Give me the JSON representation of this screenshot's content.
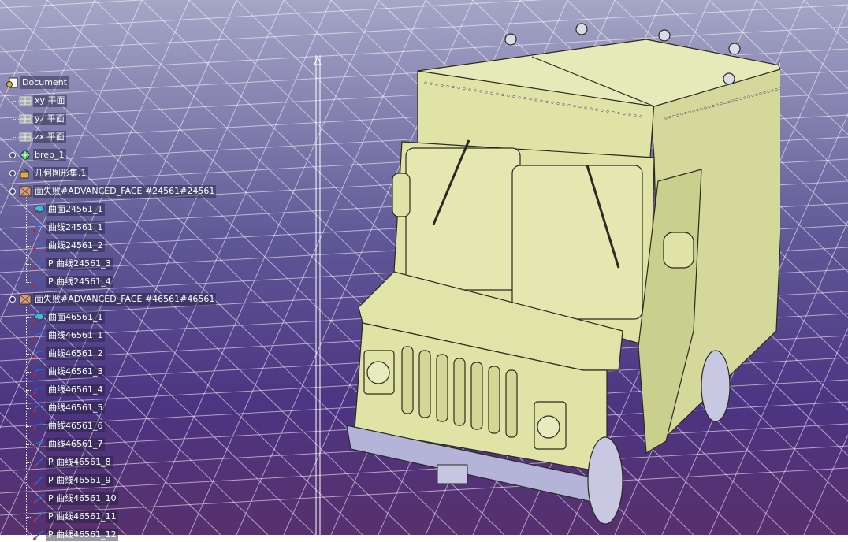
{
  "tree": {
    "root": {
      "label": "Document",
      "icon": "document-icon"
    },
    "planes": [
      {
        "label": "xy 平面",
        "icon": "plane-icon"
      },
      {
        "label": "yz 平面",
        "icon": "plane-icon"
      },
      {
        "label": "zx 平面",
        "icon": "plane-icon"
      }
    ],
    "brep": {
      "label": "brep_1",
      "icon": "body-icon"
    },
    "geoset": {
      "label": "几何图形集.1",
      "icon": "geometry-set-icon"
    },
    "failed_faces": [
      {
        "label": "面失败#ADVANCED_FACE #24561#24561",
        "icon": "failed-face-icon",
        "children": [
          {
            "label": "曲面24561_1",
            "icon": "surface-icon"
          },
          {
            "label": "曲线24561_1",
            "icon": "curve-icon"
          },
          {
            "label": "曲线24561_2",
            "icon": "curve-icon"
          },
          {
            "label": "P 曲线24561_3",
            "icon": "pcurve-icon"
          },
          {
            "label": "P 曲线24561_4",
            "icon": "pcurve-icon"
          }
        ]
      },
      {
        "label": "面失败#ADVANCED_FACE #46561#46561",
        "icon": "failed-face-icon",
        "children": [
          {
            "label": "曲面46561_1",
            "icon": "surface-icon"
          },
          {
            "label": "曲线46561_1",
            "icon": "curve-icon"
          },
          {
            "label": "曲线46561_2",
            "icon": "curve-icon"
          },
          {
            "label": "曲线46561_3",
            "icon": "curve-icon"
          },
          {
            "label": "曲线46561_4",
            "icon": "curve-icon"
          },
          {
            "label": "曲线46561_5",
            "icon": "curve-icon"
          },
          {
            "label": "曲线46561_6",
            "icon": "curve-icon"
          },
          {
            "label": "曲线46561_7",
            "icon": "curve-icon"
          },
          {
            "label": "P 曲线46561_8",
            "icon": "pcurve-icon"
          },
          {
            "label": "P 曲线46561_9",
            "icon": "pcurve-icon"
          },
          {
            "label": "P 曲线46561_10",
            "icon": "pcurve-icon"
          },
          {
            "label": "P 曲线46561_11",
            "icon": "pcurve-icon"
          },
          {
            "label": "P 曲线46561_12",
            "icon": "pcurve-icon"
          }
        ]
      }
    ]
  },
  "viewport": {
    "model": "delivery-truck-model",
    "colors": {
      "background_top": "#a5a6c6",
      "background_bottom": "#58306d",
      "grid": "#ffffff",
      "truck_body": "#dfe3a6",
      "truck_outline": "#2a2a20",
      "bumper": "#b4b4d8",
      "tree_text": "#ffffff"
    }
  }
}
